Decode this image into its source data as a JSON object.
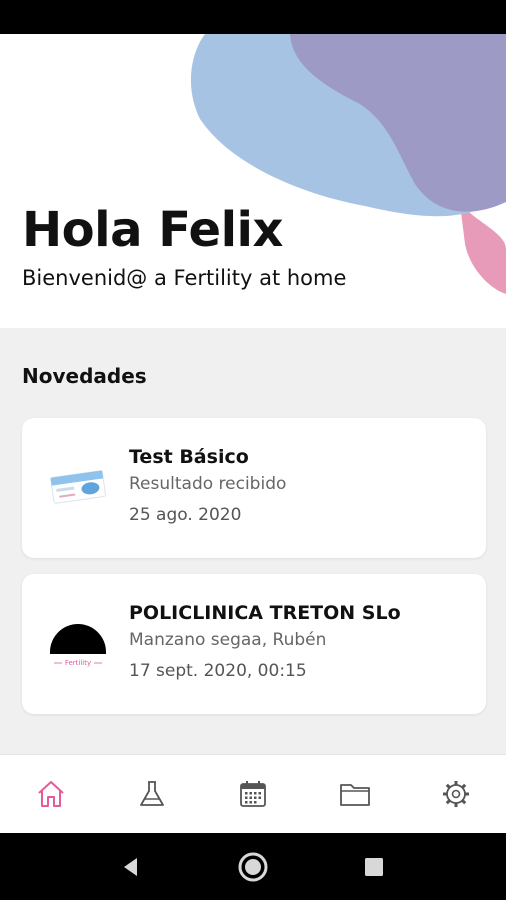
{
  "header": {
    "greeting": "Hola Felix",
    "subtitle": "Bienvenid@ a Fertility at home"
  },
  "colors": {
    "accent": "#e45b9a",
    "blob_blue": "#a6c3e3",
    "blob_purple": "#9d9ac6",
    "blob_pink": "#e89ab9",
    "icon_gray": "#555555"
  },
  "news": {
    "title": "Novedades",
    "items": [
      {
        "title": "Test Básico",
        "subtitle": "Resultado recibido",
        "date": "25 ago. 2020",
        "icon": "test-kit-image"
      },
      {
        "title": "POLICLINICA TRETON SLo",
        "subtitle": "Manzano segaa, Rubén",
        "date": "17 sept. 2020, 00:15",
        "icon": "clinic-logo",
        "logo_text": "Fertility"
      }
    ]
  },
  "bottom_nav": {
    "items": [
      {
        "icon": "home-icon",
        "active": true
      },
      {
        "icon": "flask-icon",
        "active": false
      },
      {
        "icon": "calendar-icon",
        "active": false
      },
      {
        "icon": "folder-icon",
        "active": false
      },
      {
        "icon": "gear-icon",
        "active": false
      }
    ]
  },
  "system_nav": {
    "items": [
      "back-icon",
      "home-circle-icon",
      "recents-icon"
    ]
  }
}
